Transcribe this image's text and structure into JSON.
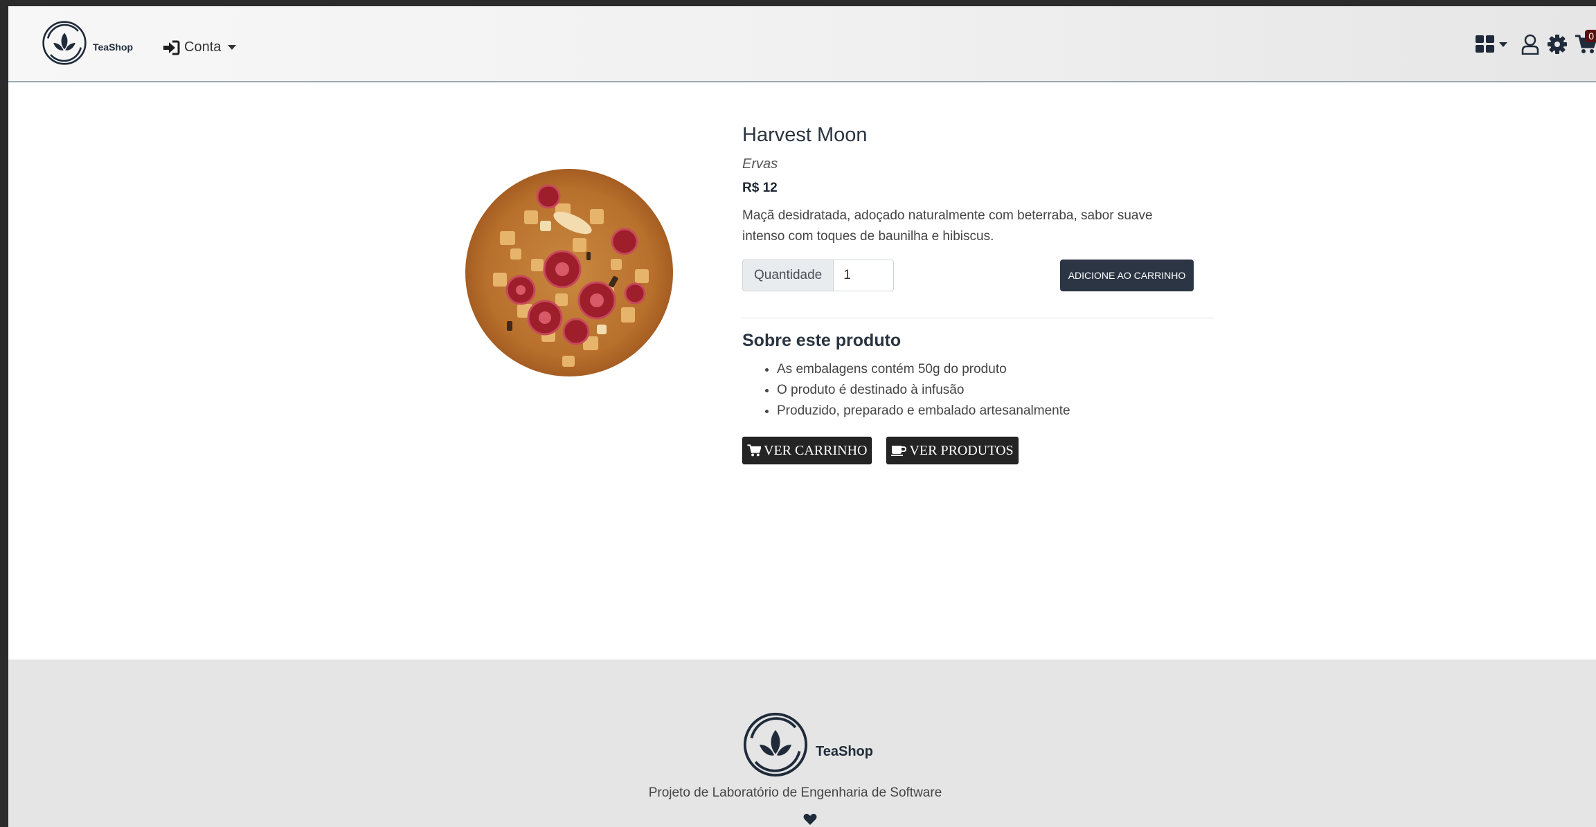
{
  "navbar": {
    "brand_name": "TeaShop",
    "account_label": "Conta",
    "cart_count": "0",
    "icons": [
      "sign-in-icon",
      "grid-icon",
      "user-icon",
      "gear-icon",
      "cart-icon"
    ]
  },
  "product": {
    "name": "Harvest Moon",
    "category": "Ervas",
    "price": "R$ 12",
    "description": "Maçã desidratada, adoçado naturalmente com beterraba, sabor suave intenso com toques de baunilha e hibiscus.",
    "quantity_label": "Quantidade",
    "quantity_value": "1",
    "add_to_cart_label": "ADICIONE AO CARRINHO"
  },
  "about": {
    "title": "Sobre este produto",
    "items": [
      "As embalagens contém 50g do produto",
      "O produto é destinado à infusão",
      "Produzido, preparado e embalado artesanalmente"
    ]
  },
  "actions": {
    "view_cart_label": "VER CARRINHO",
    "view_products_label": "VER PRODUTOS"
  },
  "footer": {
    "brand_name": "TeaShop",
    "text": "Projeto de Laboratório de Engenharia de Software"
  },
  "colors": {
    "brand_navy": "#1f2b3a",
    "button_dark": "#2b3544",
    "footer_bg": "#e5e5e5",
    "badge": "#5a0f0f"
  }
}
